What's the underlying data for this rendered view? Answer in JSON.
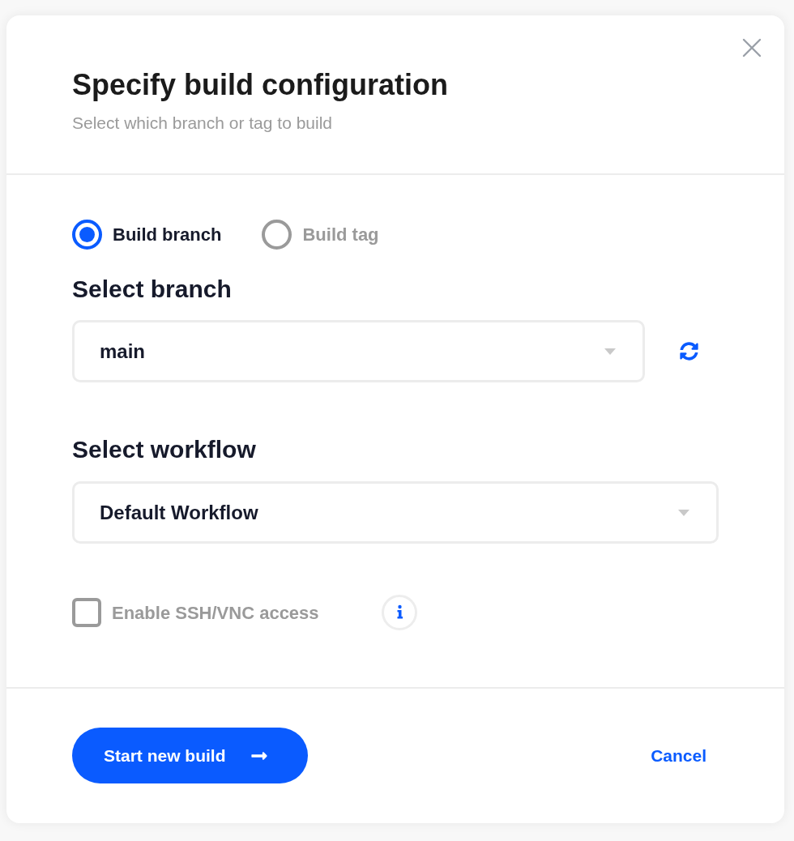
{
  "dialog": {
    "title": "Specify build configuration",
    "subtitle": "Select which branch or tag to build"
  },
  "build_type": [
    {
      "label": "Build branch",
      "selected": true
    },
    {
      "label": "Build tag",
      "selected": false
    }
  ],
  "branch": {
    "label": "Select branch",
    "value": "main"
  },
  "workflow": {
    "label": "Select workflow",
    "value": "Default Workflow"
  },
  "ssh_access": {
    "label": "Enable SSH/VNC access",
    "checked": false
  },
  "footer": {
    "primary": "Start new build",
    "cancel": "Cancel"
  }
}
